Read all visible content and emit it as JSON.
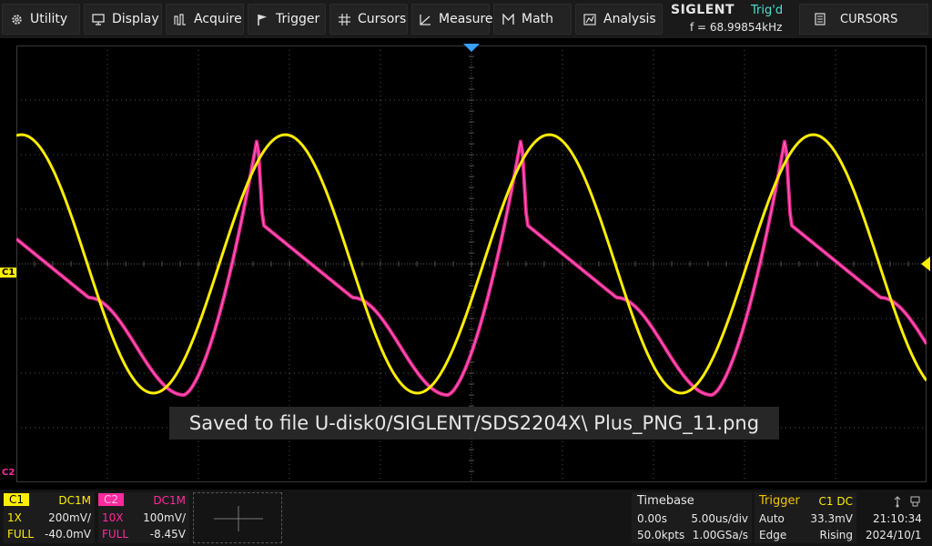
{
  "menu": {
    "utility": "Utility",
    "display": "Display",
    "acquire": "Acquire",
    "trigger": "Trigger",
    "cursors": "Cursors",
    "measure": "Measure",
    "math": "Math",
    "analysis": "Analysis"
  },
  "brand": {
    "logo": "SIGLENT",
    "trig_status": "Trig'd",
    "frequency": "f = 68.99854kHz"
  },
  "cursors_button": "CURSORS",
  "markers": {
    "c1": "C1",
    "c2": "C2"
  },
  "saved_message": "Saved to file U-disk0/SIGLENT/SDS2204X\\ Plus_PNG_11.png",
  "channel1": {
    "tag": "C1",
    "coupling": "DC1M",
    "probe": "1X",
    "scale": "200mV/",
    "bandwidth": "FULL",
    "offset": "-40.0mV"
  },
  "channel2": {
    "tag": "C2",
    "coupling": "DC1M",
    "probe": "10X",
    "scale": "100mV/",
    "bandwidth": "FULL",
    "offset": "-8.45V"
  },
  "timebase": {
    "title": "Timebase",
    "delay": "0.00s",
    "scale": "5.00us/div",
    "memory": "50.0kpts",
    "sample_rate": "1.00GSa/s"
  },
  "trigger": {
    "title": "Trigger",
    "source": "C1 DC",
    "mode": "Auto",
    "level": "33.3mV",
    "type": "Edge",
    "slope": "Rising"
  },
  "clock": {
    "time": "21:10:34",
    "date": "2024/10/1"
  },
  "colors": {
    "ch1": "#ffee00",
    "ch2": "#ff2a9e",
    "trig": "#4fe0d0",
    "grid": "#4a4a4a"
  }
}
